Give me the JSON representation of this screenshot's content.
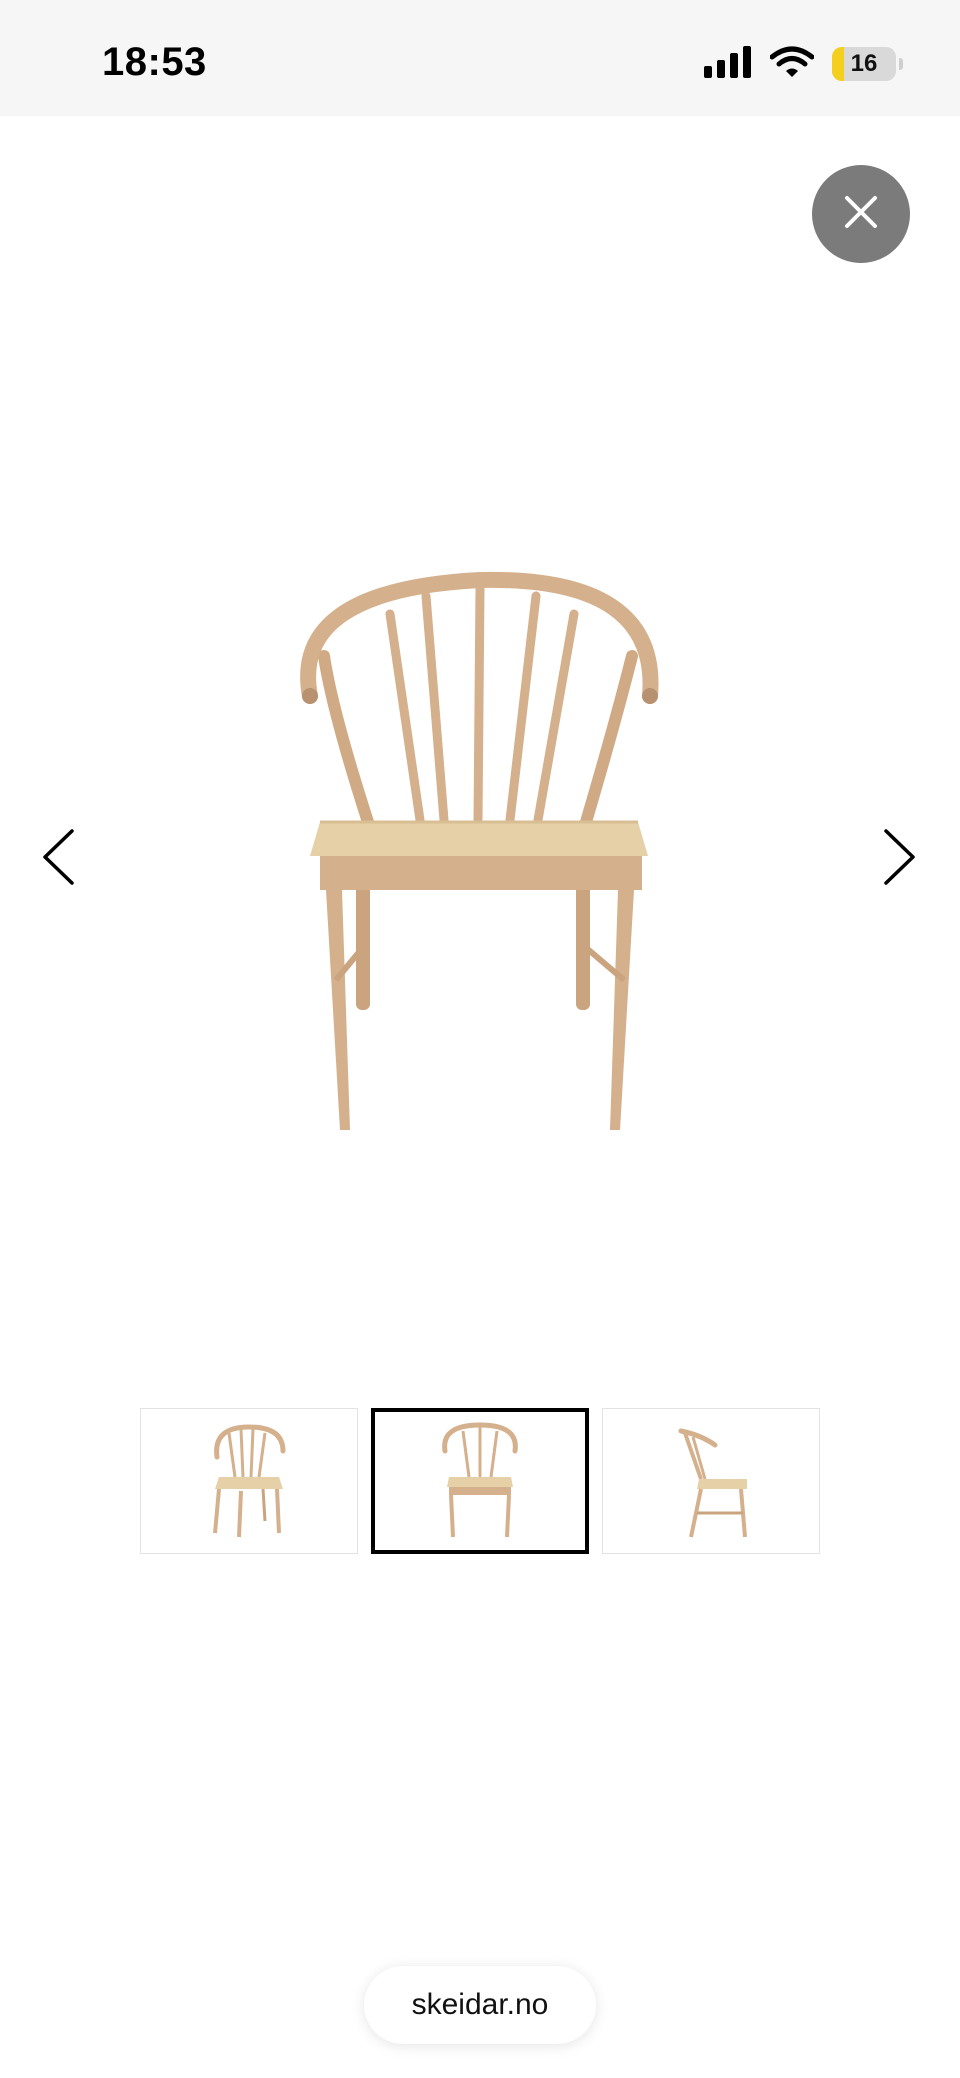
{
  "status_bar": {
    "time": "18:53",
    "battery_level": "16",
    "icons": [
      "signal-icon",
      "wifi-icon",
      "battery-icon"
    ]
  },
  "viewer": {
    "close_icon": "close-icon",
    "prev_icon": "chevron-left-icon",
    "next_icon": "chevron-right-icon",
    "main_image": "chair-front-view",
    "thumbnails": [
      {
        "image": "chair-angle-view",
        "selected": false
      },
      {
        "image": "chair-front-view",
        "selected": true
      },
      {
        "image": "chair-side-view",
        "selected": false
      }
    ]
  },
  "browser": {
    "url": "skeidar.no"
  },
  "colors": {
    "wood": "#d4b08c",
    "seat": "#e6d0a8",
    "close_button_bg": "#7b7b7b",
    "battery_fill": "#f4cf1d"
  }
}
